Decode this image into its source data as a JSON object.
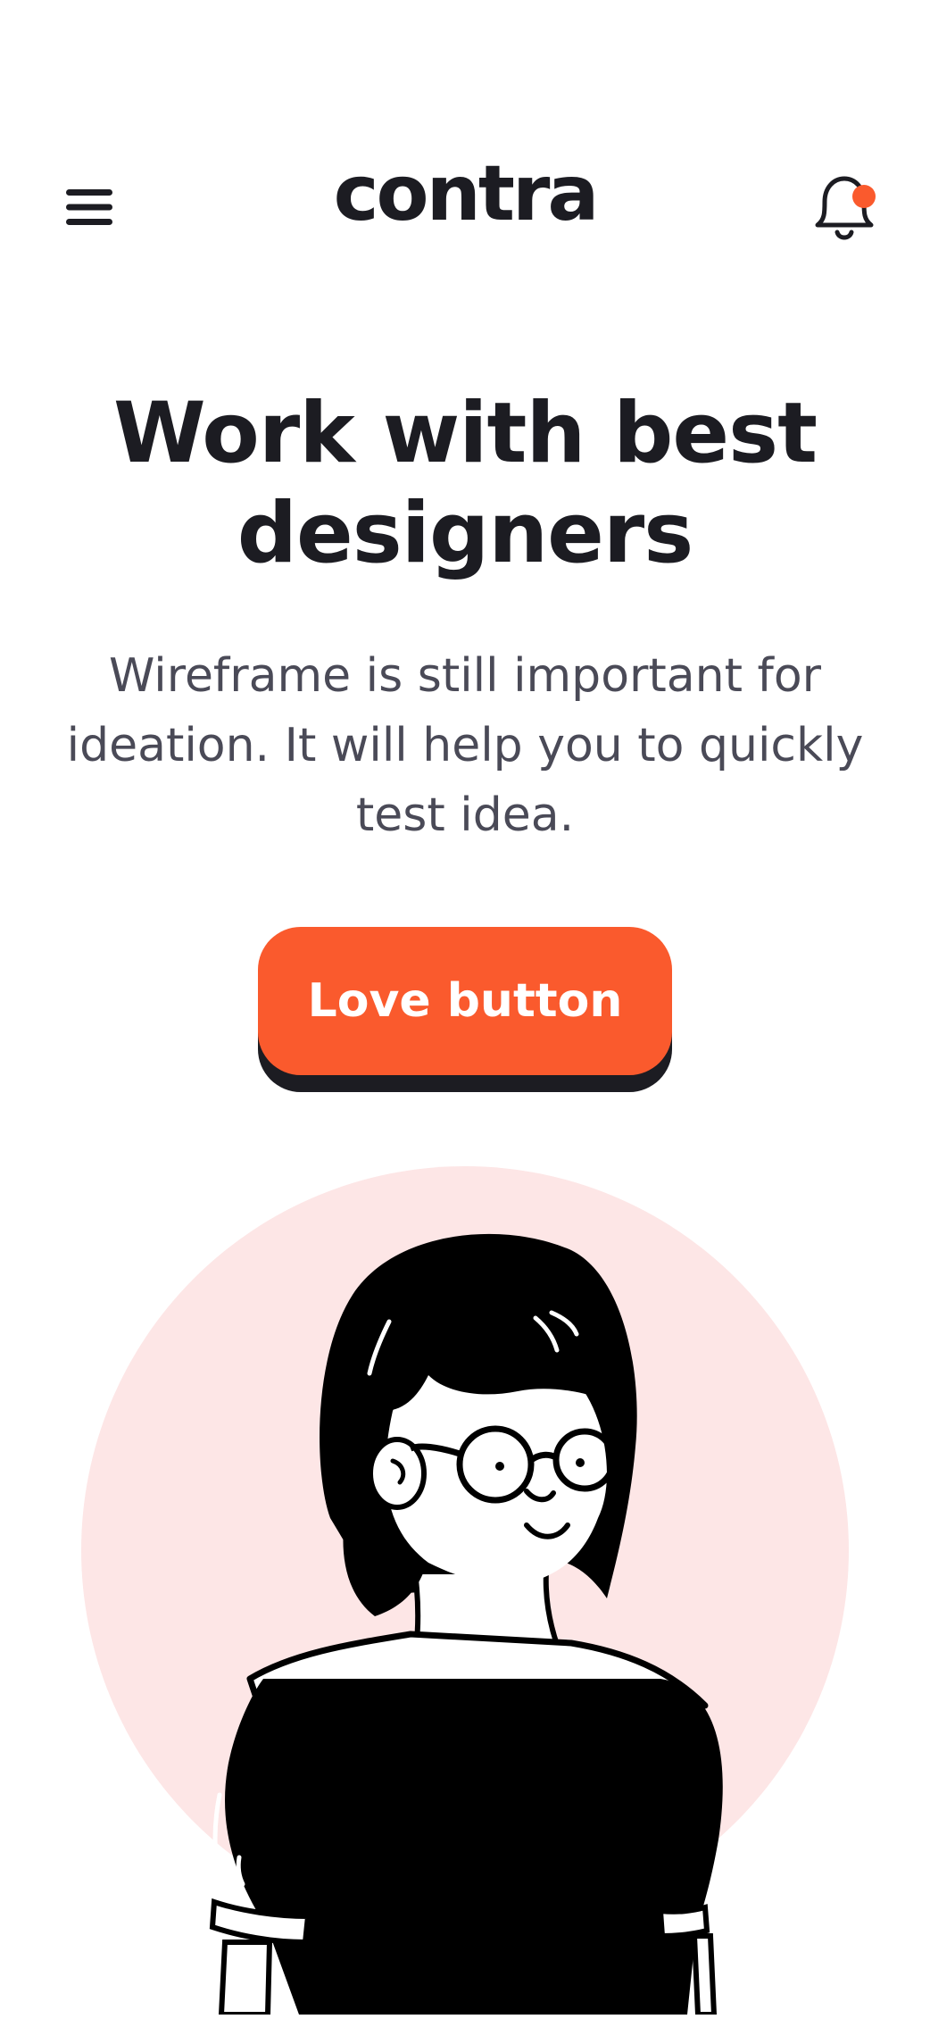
{
  "header": {
    "logo": "contra",
    "menu_icon": "hamburger-menu-icon",
    "notification_icon": "bell-icon",
    "notification_dot_color": "#fa5a2d"
  },
  "hero": {
    "title": "Work with best designers",
    "subtitle": "Wireframe is still important for ideation. It will help you to quickly test idea.",
    "cta_label": "Love button"
  },
  "colors": {
    "accent": "#fa5a2d",
    "text_primary": "#1c1c22",
    "text_secondary": "#4a4a57",
    "illustration_bg": "#fde6e6"
  }
}
